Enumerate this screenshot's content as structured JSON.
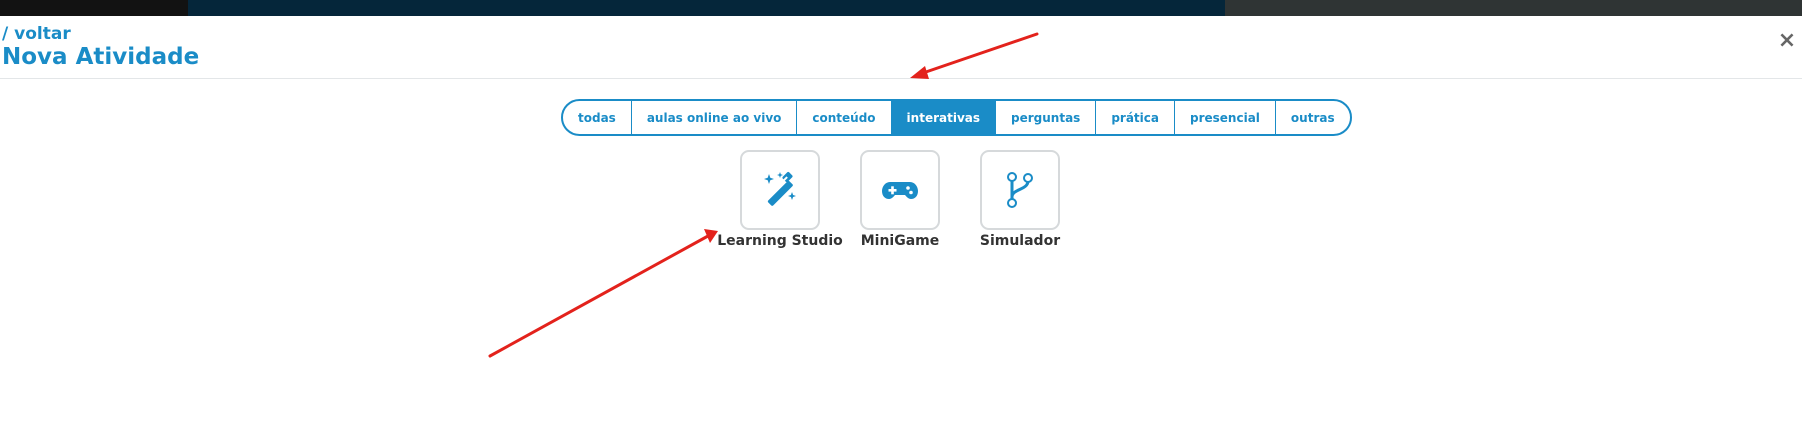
{
  "header": {
    "back_label": "/ voltar",
    "title": "Nova Atividade",
    "close_label": "×"
  },
  "tabs": [
    {
      "label": "todas",
      "active": false
    },
    {
      "label": "aulas online ao vivo",
      "active": false
    },
    {
      "label": "conteúdo",
      "active": false
    },
    {
      "label": "interativas",
      "active": true
    },
    {
      "label": "perguntas",
      "active": false
    },
    {
      "label": "prática",
      "active": false
    },
    {
      "label": "presencial",
      "active": false
    },
    {
      "label": "outras",
      "active": false
    }
  ],
  "activities": [
    {
      "label": "Learning Studio",
      "icon": "magic-wand-icon"
    },
    {
      "label": "MiniGame",
      "icon": "gamepad-icon"
    },
    {
      "label": "Simulador",
      "icon": "code-branch-icon"
    }
  ],
  "colors": {
    "accent": "#1a8cc7",
    "annotation_arrow": "#e3221c",
    "card_border": "#d6d9db"
  }
}
